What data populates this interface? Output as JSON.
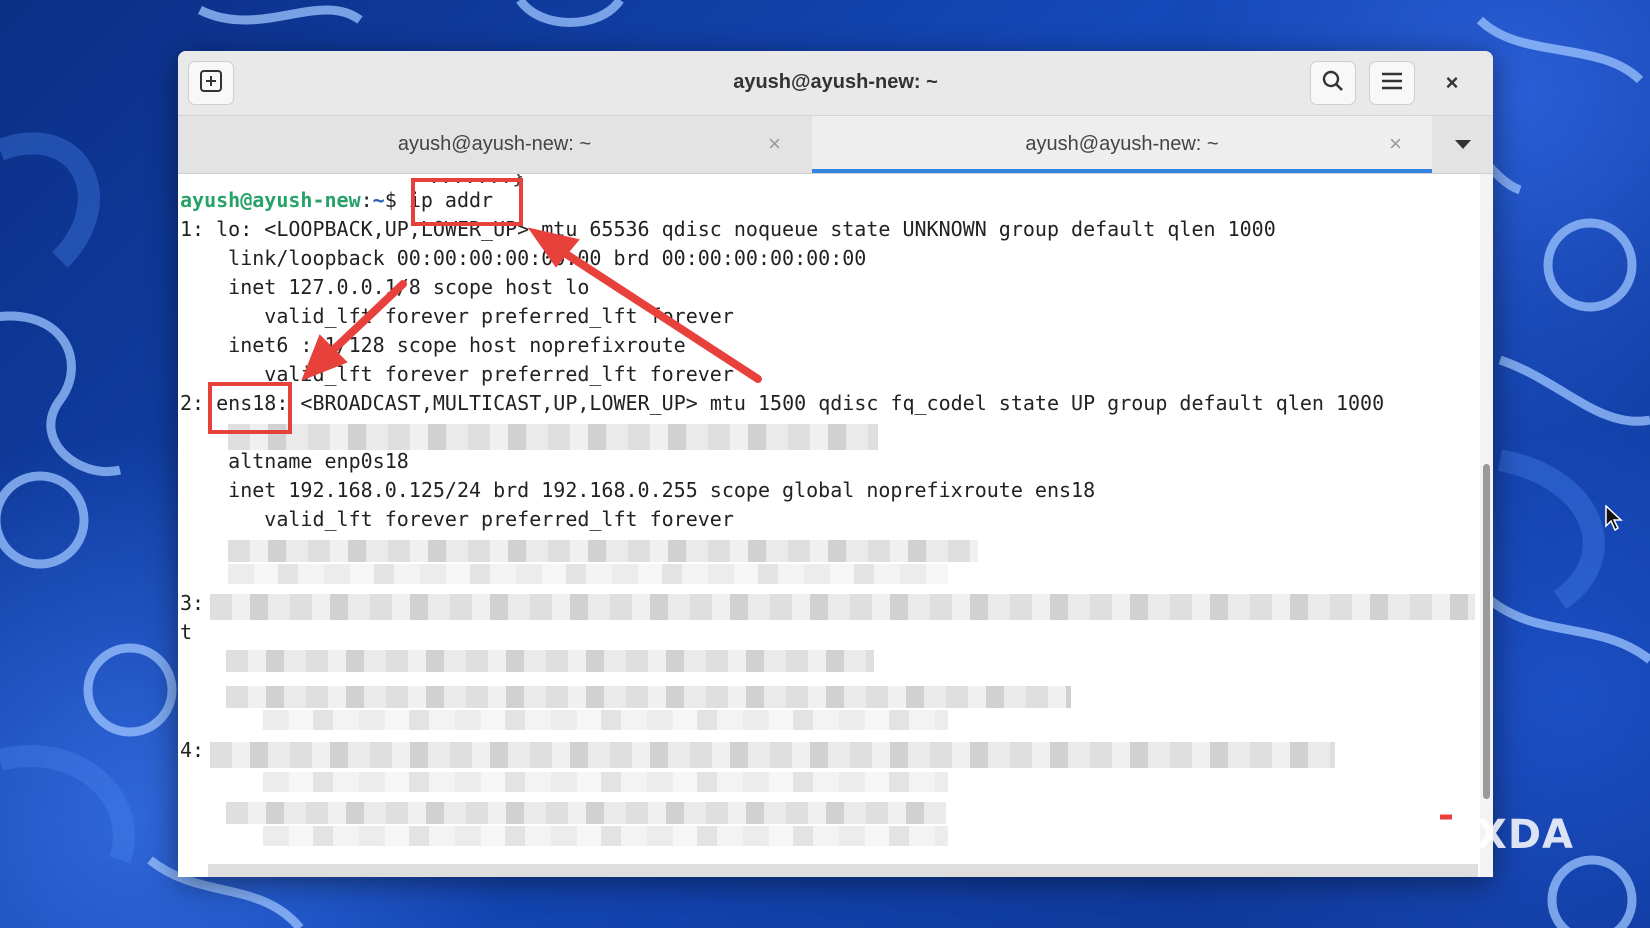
{
  "window": {
    "title": "ayush@ayush-new: ~"
  },
  "tabs": [
    {
      "label": "ayush@ayush-new: ~",
      "close": "×"
    },
    {
      "label": "ayush@ayush-new: ~",
      "close": "×"
    }
  ],
  "titlebar": {
    "close": "×"
  },
  "terminal": {
    "partial_top": ".......}",
    "prompt_user": "ayush@ayush-new",
    "prompt_sep": ":",
    "prompt_path": "~",
    "prompt_symbol": "$ ",
    "command": "ip addr",
    "lines": [
      "1: lo: <LOOPBACK,UP,LOWER_UP> mtu 65536 qdisc noqueue state UNKNOWN group default qlen 1000",
      "    link/loopback 00:00:00:00:00:00 brd 00:00:00:00:00:00",
      "    inet 127.0.0.1/8 scope host lo",
      "       valid_lft forever preferred_lft forever",
      "    inet6 ::1/128 scope host noprefixroute",
      "       valid_lft forever preferred_lft forever"
    ],
    "iface2_prefix": "2: ",
    "iface2_name": "ens18",
    "iface2_rest": ": <BROADCAST,MULTICAST,UP,LOWER_UP> mtu 1500 qdisc fq_codel state UP group default qlen 1000",
    "lines2": [
      "    altname enp0s18",
      "    inet 192.168.0.125/24 brd 192.168.0.255 scope global noprefixroute ens18",
      "       valid_lft forever preferred_lft forever"
    ],
    "iface3_prefix": "3:",
    "wrap_char": "t",
    "iface4_prefix": "4:"
  },
  "logo": {
    "text": "XDA"
  },
  "colors": {
    "highlight": "#e8413c",
    "prompt_user": "#26a269",
    "tab_active_underline": "#3584e4"
  }
}
